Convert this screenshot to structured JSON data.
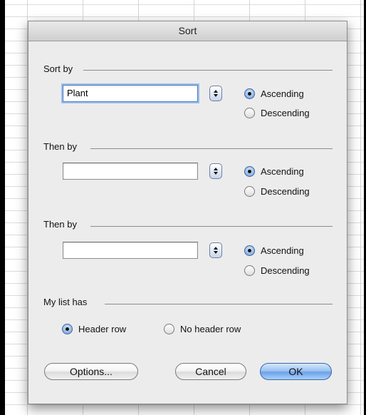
{
  "dialog": {
    "title": "Sort",
    "sort_by": {
      "label": "Sort by",
      "field_value": "Plant",
      "ascending_label": "Ascending",
      "descending_label": "Descending",
      "selected": "ascending"
    },
    "then_by_1": {
      "label": "Then by",
      "field_value": "",
      "ascending_label": "Ascending",
      "descending_label": "Descending",
      "selected": "ascending"
    },
    "then_by_2": {
      "label": "Then by",
      "field_value": "",
      "ascending_label": "Ascending",
      "descending_label": "Descending",
      "selected": "ascending"
    },
    "header": {
      "label": "My list has",
      "header_row_label": "Header row",
      "no_header_row_label": "No header row",
      "selected": "header_row"
    },
    "buttons": {
      "options": "Options...",
      "cancel": "Cancel",
      "ok": "OK"
    }
  },
  "icons": {
    "stepper": "up-down-arrows-icon",
    "radio_selected": "radio-selected-icon",
    "radio_unselected": "radio-unselected-icon"
  },
  "colors": {
    "dialog_bg": "#ececec",
    "default_button": "#8fb8ee",
    "focus_ring": "#9dbde9"
  }
}
